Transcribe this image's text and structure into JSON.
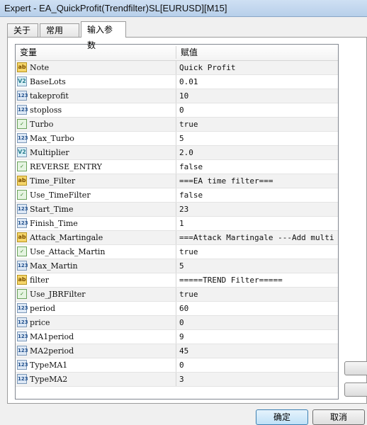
{
  "window": {
    "title": "Expert - EA_QuickProfit(Trendfilter)SL[EURUSD][M15]"
  },
  "tabs": [
    {
      "label": "关于"
    },
    {
      "label": "常用"
    },
    {
      "label": "输入参数"
    }
  ],
  "grid": {
    "columns": {
      "name": "变量",
      "value": "赋值"
    },
    "rows": [
      {
        "type": "ab",
        "icon": "ab",
        "name": "Note",
        "value": "Quick Profit"
      },
      {
        "type": "dbl",
        "icon": "V2",
        "name": "BaseLots",
        "value": "0.01"
      },
      {
        "type": "num",
        "icon": "123",
        "name": "takeprofit",
        "value": "10"
      },
      {
        "type": "num",
        "icon": "123",
        "name": "stoploss",
        "value": "0"
      },
      {
        "type": "bool",
        "icon": "✓",
        "name": "Turbo",
        "value": "true"
      },
      {
        "type": "num",
        "icon": "123",
        "name": "Max_Turbo",
        "value": "5"
      },
      {
        "type": "dbl",
        "icon": "V2",
        "name": "Multiplier",
        "value": "2.0"
      },
      {
        "type": "bool",
        "icon": "✓",
        "name": "REVERSE_ENTRY",
        "value": "false"
      },
      {
        "type": "ab",
        "icon": "ab",
        "name": "Time_Filter",
        "value": "===EA time filter==="
      },
      {
        "type": "bool",
        "icon": "✓",
        "name": "Use_TimeFilter",
        "value": "false"
      },
      {
        "type": "num",
        "icon": "123",
        "name": "Start_Time",
        "value": "23"
      },
      {
        "type": "num",
        "icon": "123",
        "name": "Finish_Time",
        "value": "1"
      },
      {
        "type": "ab",
        "icon": "ab",
        "name": "Attack_Martingale",
        "value": "===Attack Martingale ---Add multi..."
      },
      {
        "type": "bool",
        "icon": "✓",
        "name": "Use_Attack_Martin",
        "value": "true"
      },
      {
        "type": "num",
        "icon": "123",
        "name": "Max_Martin",
        "value": "5"
      },
      {
        "type": "ab",
        "icon": "ab",
        "name": "filter",
        "value": "=====TREND Filter====="
      },
      {
        "type": "bool",
        "icon": "✓",
        "name": "Use_JBRFilter",
        "value": "true"
      },
      {
        "type": "num",
        "icon": "123",
        "name": "period",
        "value": "60"
      },
      {
        "type": "num",
        "icon": "123",
        "name": "price",
        "value": "0"
      },
      {
        "type": "num",
        "icon": "123",
        "name": "MA1period",
        "value": "9"
      },
      {
        "type": "num",
        "icon": "123",
        "name": "MA2period",
        "value": "45"
      },
      {
        "type": "num",
        "icon": "123",
        "name": "TypeMA1",
        "value": "0"
      },
      {
        "type": "num",
        "icon": "123",
        "name": "TypeMA2",
        "value": "3"
      }
    ]
  },
  "buttons": {
    "ok": "确定",
    "cancel": "取消"
  }
}
